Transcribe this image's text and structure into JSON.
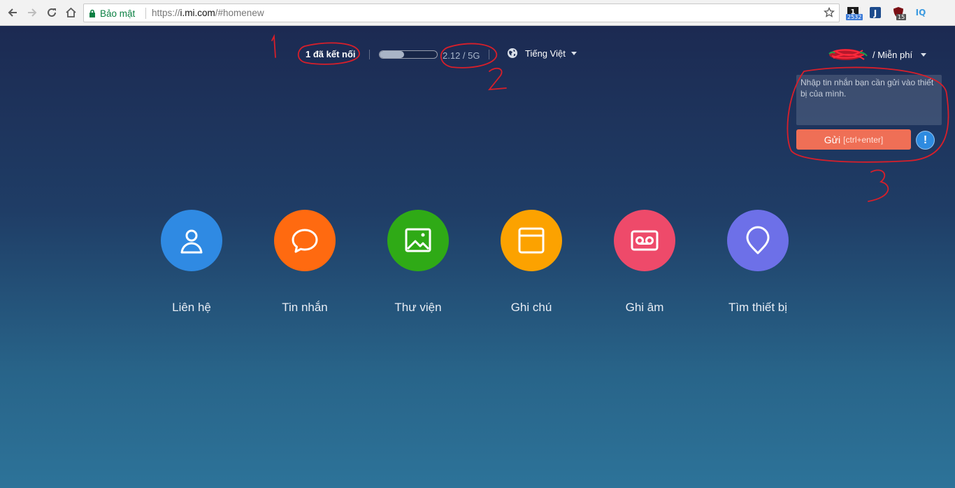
{
  "browser": {
    "secure_label": "Bảo mật",
    "url_scheme": "https://",
    "url_host": "i.mi.com",
    "url_path": "/#homenew",
    "extensions": [
      {
        "name": "feedly",
        "badge": "2532",
        "color": "#1a1a1a"
      },
      {
        "name": "j-extension",
        "badge": "",
        "color": "#1c4b8c"
      },
      {
        "name": "ublock",
        "badge": "15",
        "color": "#7a0f14"
      },
      {
        "name": "iq",
        "badge": "",
        "color": "#3d9be0"
      }
    ]
  },
  "header": {
    "connected": "1 đã kết nối",
    "storage": {
      "text": "2.12 / 5G",
      "used_fraction": 0.424
    },
    "language": "Tiếng Việt",
    "plan": "/ Miễn phí"
  },
  "message_panel": {
    "placeholder": "Nhập tin nhắn bạn cần gửi vào thiết bị của mình.",
    "send_label": "Gửi",
    "send_shortcut": "[ctrl+enter]",
    "info_symbol": "!"
  },
  "annotations": [
    "1",
    "2",
    "3"
  ],
  "features": [
    {
      "label": "Liên hệ",
      "icon": "contact-icon",
      "color": "#2f8ae3"
    },
    {
      "label": "Tin nhắn",
      "icon": "message-icon",
      "color": "#ff6a10"
    },
    {
      "label": "Thư viện",
      "icon": "gallery-icon",
      "color": "#2faa16"
    },
    {
      "label": "Ghi chú",
      "icon": "note-icon",
      "color": "#fca200"
    },
    {
      "label": "Ghi âm",
      "icon": "recorder-icon",
      "color": "#ee4a6a"
    },
    {
      "label": "Tìm thiết bị",
      "icon": "location-icon",
      "color": "#6d70e8"
    }
  ]
}
